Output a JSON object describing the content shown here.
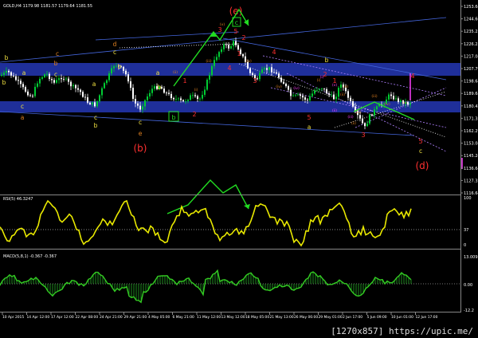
{
  "main": {
    "header": "GOLD,H4 1179.98 1181.57 1179.64 1181.55",
    "price_ticks": [
      "1253.64",
      "1244.60",
      "1235.25",
      "1226.25",
      "1217.04",
      "1207.79",
      "1198.64",
      "1189.68",
      "1180.42",
      "1171.33",
      "1162.29",
      "1153.04",
      "1145.24",
      "1136.64",
      "1127.32",
      "1116.64"
    ],
    "wave_labels": [
      {
        "t": "b",
        "c": "#f0e040"
      },
      {
        "t": "b",
        "c": "#f0e040"
      },
      {
        "t": "a",
        "c": "#f0e040"
      },
      {
        "t": "c",
        "c": "#f0e040"
      },
      {
        "t": "a",
        "c": "#e08020"
      },
      {
        "t": "c",
        "c": "#f0e040"
      },
      {
        "t": "c",
        "c": "#e08020"
      },
      {
        "t": "b",
        "c": "#e08020"
      },
      {
        "t": "d",
        "c": "#e08020"
      },
      {
        "t": "c",
        "c": "#f0e040"
      },
      {
        "t": "b",
        "c": "#f0e040"
      },
      {
        "t": "a",
        "c": "#f0e040"
      },
      {
        "t": "e",
        "c": "#e08020"
      },
      {
        "t": "c",
        "c": "#f0e040"
      },
      {
        "t": "(b)",
        "c": "#ff3030"
      },
      {
        "t": "a",
        "c": "#f0e040"
      },
      {
        "t": "b",
        "c": "#f0e040"
      },
      {
        "t": "1",
        "c": "#ff3030"
      },
      {
        "t": "2",
        "c": "#ff3030"
      },
      {
        "t": "(e)",
        "c": "#ff3030"
      },
      {
        "t": "3",
        "c": "#ff3030"
      },
      {
        "t": "5",
        "c": "#ff3030"
      },
      {
        "t": "2",
        "c": "#ff3030"
      },
      {
        "t": "1",
        "c": "#ff3030"
      },
      {
        "t": "4",
        "c": "#ff3030"
      },
      {
        "t": "3",
        "c": "#ff3030"
      },
      {
        "t": "4",
        "c": "#ff3030"
      },
      {
        "t": "b",
        "c": "#f0e040"
      },
      {
        "t": "5",
        "c": "#ff3030"
      },
      {
        "t": "a",
        "c": "#f0e040"
      },
      {
        "t": "2",
        "c": "#ff3030"
      },
      {
        "t": "1",
        "c": "#ff3030"
      },
      {
        "t": "3",
        "c": "#ff3030"
      },
      {
        "t": "4",
        "c": "#ff3030"
      },
      {
        "t": "5",
        "c": "#ff3030"
      },
      {
        "t": "c",
        "c": "#f0e040"
      },
      {
        "t": "(d)",
        "c": "#ff3030"
      },
      {
        "t": "c",
        "c": "#f0e040"
      },
      {
        "t": "b",
        "c": "#f0e040"
      }
    ],
    "mini_labels": [
      {
        "t": "(v)",
        "c": "#e08020"
      },
      {
        "t": "(iii)",
        "c": "#e08020"
      },
      {
        "t": "(iv)",
        "c": "#e08020"
      },
      {
        "t": "(i)",
        "c": "#e08020"
      },
      {
        "t": "(ii)",
        "c": "#e08020"
      },
      {
        "t": "(iv)",
        "c": "#e08020"
      },
      {
        "t": "(v)",
        "c": "#e08020"
      },
      {
        "t": "(iii)",
        "c": "#e08020"
      },
      {
        "t": "(i)",
        "c": "#e08020"
      },
      {
        "t": "(ii)",
        "c": "#e08020"
      },
      {
        "t": "(iv)",
        "c": "#ff40ff"
      },
      {
        "t": "(i)",
        "c": "#ff40ff"
      },
      {
        "t": "(ii)",
        "c": "#ff40ff"
      },
      {
        "t": "(iii)",
        "c": "#ff40ff"
      },
      {
        "t": "(v)",
        "c": "#ff40ff"
      },
      {
        "t": "(iv)",
        "c": "#e08020"
      },
      {
        "t": "(iii)",
        "c": "#e08020"
      },
      {
        "t": "(v)",
        "c": "#e08020"
      },
      {
        "t": "(ii)",
        "c": "#e08020"
      }
    ],
    "box_c_label": "c",
    "box_b_label": "b"
  },
  "rsi": {
    "header": "RSI(5) 46.3247",
    "ticks": [
      "100",
      "37",
      "0"
    ]
  },
  "macd": {
    "header": "MACD(5,8,1) -0.367 -0.367",
    "ticks": [
      "13.009",
      "0.00",
      "-12.2"
    ]
  },
  "time_axis": [
    "10 Apr 2015",
    "14 Apr 12:00",
    "17 Apr 12:00",
    "22 Apr 08:00",
    "24 Apr 21:00",
    "29 Apr 21:00",
    "4 May 05:00",
    "6 May 21:00",
    "11 May 12:00",
    "13 May 12:00",
    "18 May 05:00",
    "21 May 13:00",
    "26 May 06:00",
    "29 May 01:00",
    "2 Jun 17:00",
    "5 Jun 09:00",
    "10 Jun 01:00",
    "12 Jun 17:00"
  ],
  "caption": "[1270x857] https://upic.me/",
  "colors": {
    "background": "#000000",
    "band": "#1f2f9a",
    "bull": "#00cc33",
    "bear": "#ffffff",
    "rsi_line": "#e8e800",
    "macd": "#33cc22",
    "trendline": "#4466dd",
    "forecast": "#22dd22",
    "wave_red": "#ff3030",
    "wave_orange": "#e08020",
    "wave_yellow": "#f0e040"
  }
}
